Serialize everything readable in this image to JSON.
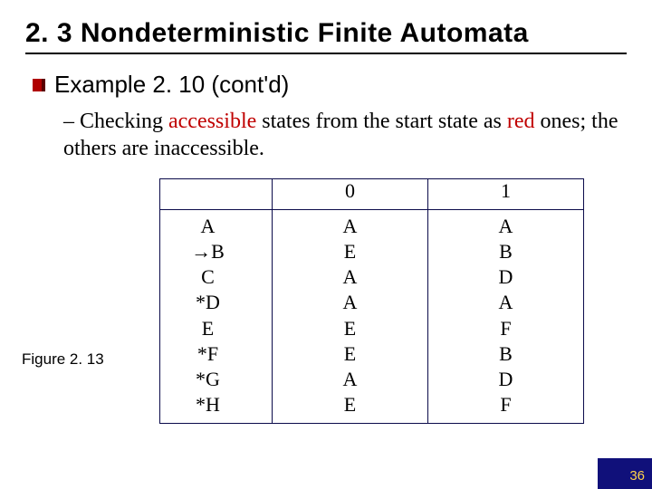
{
  "title": "2. 3 Nondeterministic Finite Automata",
  "bullet1": "Example 2. 10 (cont'd)",
  "sub1_prefix": "– Checking ",
  "sub1_red1": "accessible",
  "sub1_mid": " states from the start state as ",
  "sub1_red2": "red",
  "sub1_suffix": " ones; the others are inaccessible.",
  "figure_label": "Figure 2. 13",
  "table": {
    "headers": {
      "state": "",
      "c0": "0",
      "c1": "1"
    },
    "states": [
      "A",
      "→B",
      "C",
      "*D",
      "E",
      "*F",
      "*G",
      "*H"
    ],
    "col0": [
      "A",
      "E",
      "A",
      "A",
      "E",
      "E",
      "A",
      "E"
    ],
    "col1": [
      "A",
      "B",
      "D",
      "A",
      "F",
      "B",
      "D",
      "F"
    ]
  },
  "page_number": "36"
}
